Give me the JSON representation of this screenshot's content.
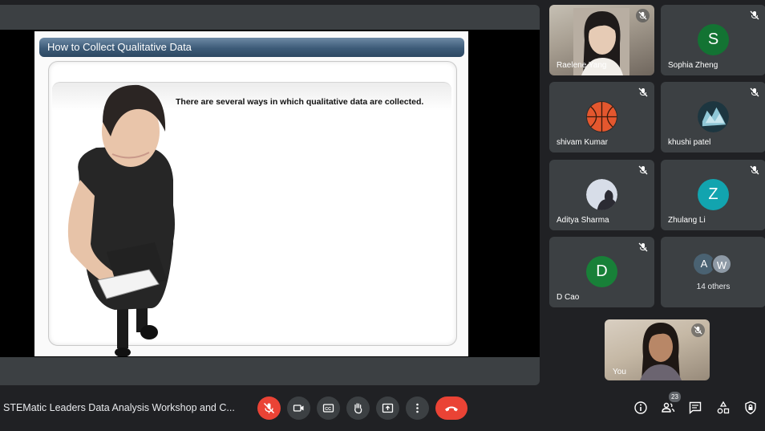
{
  "slide": {
    "title": "How to Collect Qualitative Data",
    "body": "There are several ways in which qualitative data are collected."
  },
  "participants": [
    {
      "name": "Raelene Yang",
      "type": "video"
    },
    {
      "name": "Sophia Zheng",
      "initial": "S",
      "color": "#137333"
    },
    {
      "name": "shivam Kumar",
      "type": "image",
      "icon": "basketball-icon"
    },
    {
      "name": "khushi patel",
      "type": "image",
      "icon": "ice-photo-icon"
    },
    {
      "name": "Aditya Sharma",
      "type": "image",
      "icon": "silhouette-photo-icon"
    },
    {
      "name": "Zhulang Li",
      "initial": "Z",
      "color": "#12a4af"
    },
    {
      "name": "D Cao",
      "initial": "D",
      "color": "#188038"
    }
  ],
  "others": {
    "initial_a": "A",
    "initial_w": "W",
    "label": "14 others"
  },
  "self": {
    "name": "You"
  },
  "meeting": {
    "title": "STEMatic Leaders Data Analysis Workshop and C..."
  },
  "people_count": "23",
  "colors": {
    "end_call": "#ea4335",
    "tile": "#3c4043",
    "background": "#202124"
  }
}
